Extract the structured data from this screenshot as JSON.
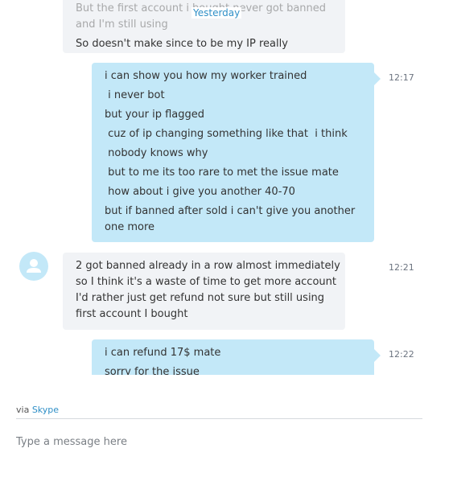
{
  "divider": {
    "label": "Yesterday"
  },
  "messages": [
    {
      "direction": "incoming",
      "time": "",
      "lines": [
        "But the first account i bought never got banned",
        "and I'm still using",
        "So doesn't make since to be my IP really"
      ]
    },
    {
      "direction": "outgoing",
      "time": "12:17",
      "lines": [
        "i can show you how my worker trained",
        " i never bot",
        "but your ip flagged",
        " cuz of ip changing something like that  i think",
        " nobody knows why",
        " but to me its too rare to met the issue mate",
        " how about i give you another 40-70",
        "but if banned after sold i can't give you another one more"
      ]
    },
    {
      "direction": "incoming",
      "time": "12:21",
      "lines": [
        "2 got banned already in a row almost immediately",
        "so I think it's a waste of time to get more account",
        "I'd rather just get refund not sure but still using",
        "first account I bought"
      ]
    },
    {
      "direction": "outgoing",
      "time": "12:22",
      "lines": [
        "i can refund 17$ mate",
        "sorry for the issue"
      ]
    }
  ],
  "footer": {
    "via_prefix": "via",
    "via_link": "Skype",
    "composer_placeholder": "Type a message here"
  },
  "colors": {
    "incoming_bubble": "#f1f3f6",
    "outgoing_bubble": "#c3e8f8",
    "link_blue": "#2f8fc7"
  },
  "icons": {
    "avatar": "default-user-avatar-icon"
  }
}
